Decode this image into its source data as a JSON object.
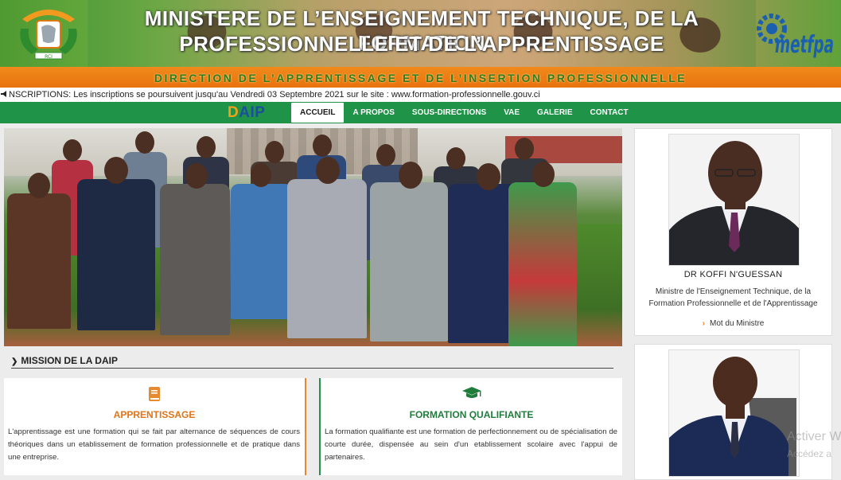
{
  "banner": {
    "title_line1": "MINISTERE DE L’ENSEIGNEMENT TECHNIQUE, DE LA FORMATION",
    "title_line2": "PROFESSIONNELLE ET DE L’APPRENTISSAGE",
    "subtitle": "DIRECTION DE L’APPRENTISSAGE ET DE L’INSERTION PROFESSIONNELLE",
    "right_logo_text": "metfpa",
    "coat_of_arms_text": "RCI"
  },
  "ticker": {
    "icon": "megaphone-icon",
    "text": "NSCRIPTIONS: Les inscriptions se poursuivent jusqu'au Vendredi 03 Septembre 2021 sur le site : www.formation-professionnelle.gouv.ci"
  },
  "navbar": {
    "logo_first": "D",
    "logo_rest": "AIP",
    "items": [
      {
        "label": "ACCUEIL",
        "active": true
      },
      {
        "label": "A PROPOS",
        "active": false
      },
      {
        "label": "SOUS-DIRECTIONS",
        "active": false
      },
      {
        "label": "VAE",
        "active": false
      },
      {
        "label": "GALERIE",
        "active": false
      },
      {
        "label": "CONTACT",
        "active": false
      }
    ]
  },
  "mission": {
    "title": "MISSION DE LA DAIP",
    "cards": [
      {
        "icon": "book-icon",
        "title": "APPRENTISSAGE",
        "text": "L'apprentissage est une formation qui se fait par alternance de séquences de cours théoriques dans un etablissement de formation professionnelle et de pratique dans une entreprise."
      },
      {
        "icon": "graduation-cap-icon",
        "title": "FORMATION QUALIFIANTE",
        "text": "La formation qualifiante est une formation de perfectionnement ou de spécialisation de courte durée, dispensée au sein d'un etablissement scolaire avec l'appui de partenaires."
      }
    ]
  },
  "sidebar": {
    "minister": {
      "name": "DR KOFFI N'GUESSAN",
      "role": "Ministre de l'Enseignement Technique, de la Formation Professionnelle et de l'Apprentissage",
      "link": "Mot du Ministre"
    }
  },
  "watermark": {
    "line1": "Activer W",
    "line2": "Accédez a"
  },
  "colors": {
    "nav_green": "#1f9348",
    "accent_orange": "#e58a2e",
    "banner_orange": "#e9720d"
  }
}
